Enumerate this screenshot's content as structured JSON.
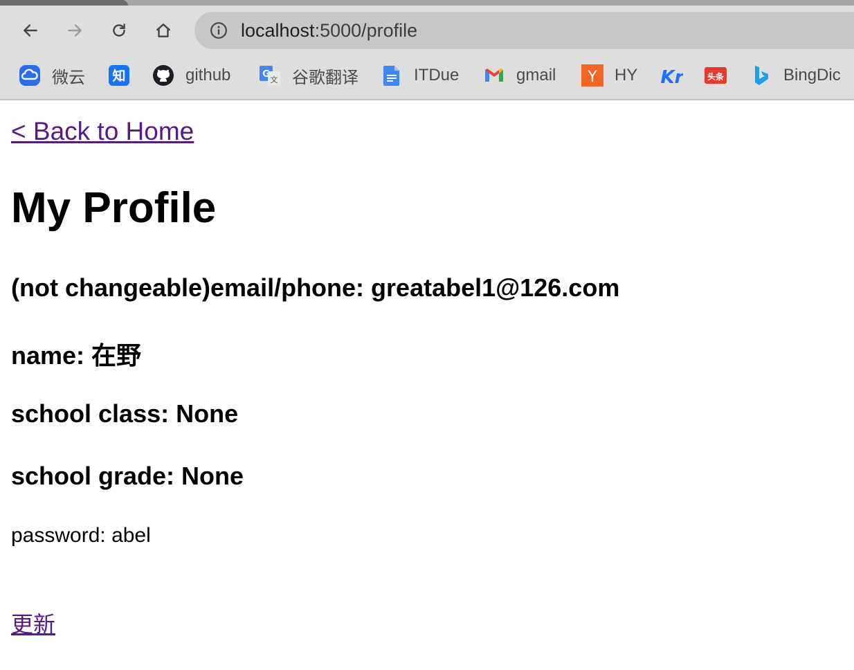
{
  "browser": {
    "url_host": "localhost",
    "url_rest": ":5000/profile",
    "bookmarks": [
      {
        "label": "微云",
        "icon": "weiyun-cloud-icon",
        "color": "#2b6bf0"
      },
      {
        "label": "",
        "icon": "zhihu-icon",
        "glyph": "知",
        "color": "#1772f6"
      },
      {
        "label": "github",
        "icon": "github-icon",
        "color": "#1b1f23"
      },
      {
        "label": "谷歌翻译",
        "icon": "google-translate-icon",
        "color": "#4285f4"
      },
      {
        "label": "ITDue",
        "icon": "google-docs-icon",
        "color": "#4285f4"
      },
      {
        "label": "gmail",
        "icon": "gmail-icon",
        "color": "#ea4335"
      },
      {
        "label": "HY",
        "icon": "hacker-news-y-icon",
        "glyph": "Y",
        "color": "#f26522"
      },
      {
        "label": "",
        "icon": "36kr-icon",
        "glyph": "Kr",
        "color": "#1e6fff"
      },
      {
        "label": "",
        "icon": "toutiao-icon",
        "glyph": "头条",
        "color": "#e8392b"
      },
      {
        "label": "BingDic",
        "icon": "bing-icon",
        "color": "#1aa1e6"
      }
    ]
  },
  "page": {
    "back_link": "< Back to Home",
    "title": "My Profile",
    "email_line": "(not changeable)email/phone: greatabel1@126.com",
    "name_line": "name: 在野",
    "class_line": "school class: None",
    "grade_line": "school grade: None",
    "password_line": "password: abel",
    "update_link": "更新"
  }
}
